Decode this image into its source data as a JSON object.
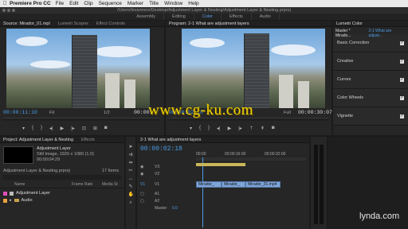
{
  "menubar": {
    "apple_glyph": "",
    "app_name": "Premiere Pro CC",
    "items": [
      "File",
      "Edit",
      "Clip",
      "Sequence",
      "Marker",
      "Title",
      "Window",
      "Help"
    ]
  },
  "window": {
    "path": "/Users/lessoners/Desktop/Adjustment Layer & Nesting/Adjustment Layer & Nesting.prproj"
  },
  "workspaces": [
    {
      "label": "Assembly",
      "active": false
    },
    {
      "label": "Editing",
      "active": false
    },
    {
      "label": "Color",
      "active": true
    },
    {
      "label": "Effects",
      "active": false
    },
    {
      "label": "Audio",
      "active": false
    }
  ],
  "source_monitor": {
    "tabs": [
      "Source: Mirador_01.mpl",
      "Lumetri Scopes",
      "Effect Controls"
    ],
    "timecode": "00:00:11:10",
    "fit": "Fit",
    "resolution": "1/2",
    "duration": "00:00:"
  },
  "program_monitor": {
    "title": "Program: 2-1 What are adjustment layers",
    "timecode": "00:00:02:18",
    "fit": "Full",
    "duration": "00:00:30:07"
  },
  "lumetri": {
    "title": "Lumetri Color",
    "master_tab": "Master * Mirado...",
    "sequence_tab": "2-1 What are adjust...",
    "sections": [
      {
        "label": "Basic Correction",
        "checked": "✓"
      },
      {
        "label": "Creative",
        "checked": "✓"
      },
      {
        "label": "Curves",
        "checked": "✓"
      },
      {
        "label": "Color Wheels",
        "checked": "✓"
      },
      {
        "label": "Vignette",
        "checked": "✓"
      }
    ]
  },
  "project": {
    "tabs": [
      "Project: Adjustment Layer & Nesting",
      "Effects"
    ],
    "item_name": "Adjustment Layer",
    "item_info": "Still Image, 1920 x 1080 (1.0)",
    "item_duration": "00:00:04:29",
    "project_file": "Adjustment Layer & Nesting.prproj",
    "item_count": "17 Items",
    "columns": [
      "Name",
      "Frame Rate",
      "Media St"
    ],
    "rows": [
      {
        "name": "Adjustment Layer",
        "color": "#e24fb7"
      },
      {
        "name": "Audio",
        "color": "#e8a13c"
      }
    ]
  },
  "timeline": {
    "tab": "2-1 What are adjustment layers",
    "timecode": "00:00:02:18",
    "ruler": [
      "00:00",
      "00:00:16:00",
      "00:00:32:00"
    ],
    "video_tracks": [
      "V3",
      "V2",
      "V1"
    ],
    "audio_tracks": [
      "A1",
      "A2"
    ],
    "master_label": "Master",
    "master_value": "0.0",
    "clips": [
      "Mirador_",
      "Mirador_",
      "Mirador_01.mp4"
    ]
  },
  "watermark": {
    "text": "www.cg-ku.com"
  },
  "brand": {
    "text": "lynda.com"
  },
  "colors": {
    "accent_blue": "#4a9de6",
    "clip_blue": "#7ea4d8",
    "watermark_yellow": "#f2d400"
  },
  "icons": [
    "apple-icon",
    "play-icon",
    "step-back-icon",
    "step-forward-icon",
    "mark-in-icon",
    "mark-out-icon",
    "wrench-icon",
    "selection-tool-icon",
    "razor-tool-icon",
    "hand-tool-icon",
    "eye-icon",
    "lock-icon"
  ]
}
